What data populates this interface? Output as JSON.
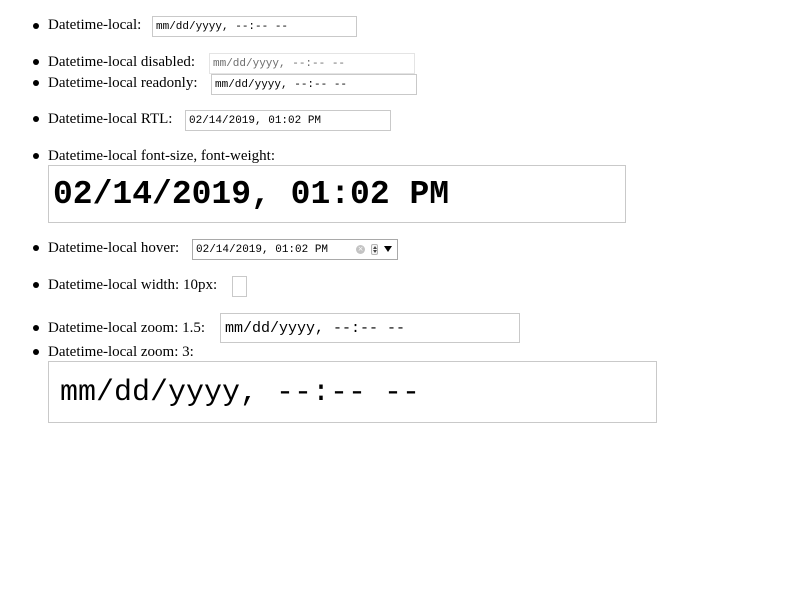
{
  "items": [
    {
      "label": "Datetime-local:",
      "value": "mm/dd/yyyy, --:-- --"
    },
    {
      "label": "Datetime-local disabled:",
      "value": "mm/dd/yyyy, --:-- --"
    },
    {
      "label": "Datetime-local readonly:",
      "value": "mm/dd/yyyy, --:-- --"
    },
    {
      "label": "Datetime-local RTL:",
      "value": "02/14/2019, 01:02 PM"
    },
    {
      "label": "Datetime-local font-size, font-weight:",
      "value": "02/14/2019, 01:02 PM"
    },
    {
      "label": "Datetime-local hover:",
      "value": "02/14/2019, 01:02 PM"
    },
    {
      "label": "Datetime-local width: 10px:",
      "value": ""
    },
    {
      "label": "Datetime-local zoom: 1.5:",
      "value": "mm/dd/yyyy, --:-- --"
    },
    {
      "label": "Datetime-local zoom: 3:",
      "value": "mm/dd/yyyy, --:-- --"
    }
  ],
  "icons": {
    "clear": "clear-icon",
    "spin": "spin-button-icon",
    "dropdown": "dropdown-arrow-icon"
  },
  "colors": {
    "border": "#c9c9c9",
    "disabled_text": "#6d6d6d"
  }
}
